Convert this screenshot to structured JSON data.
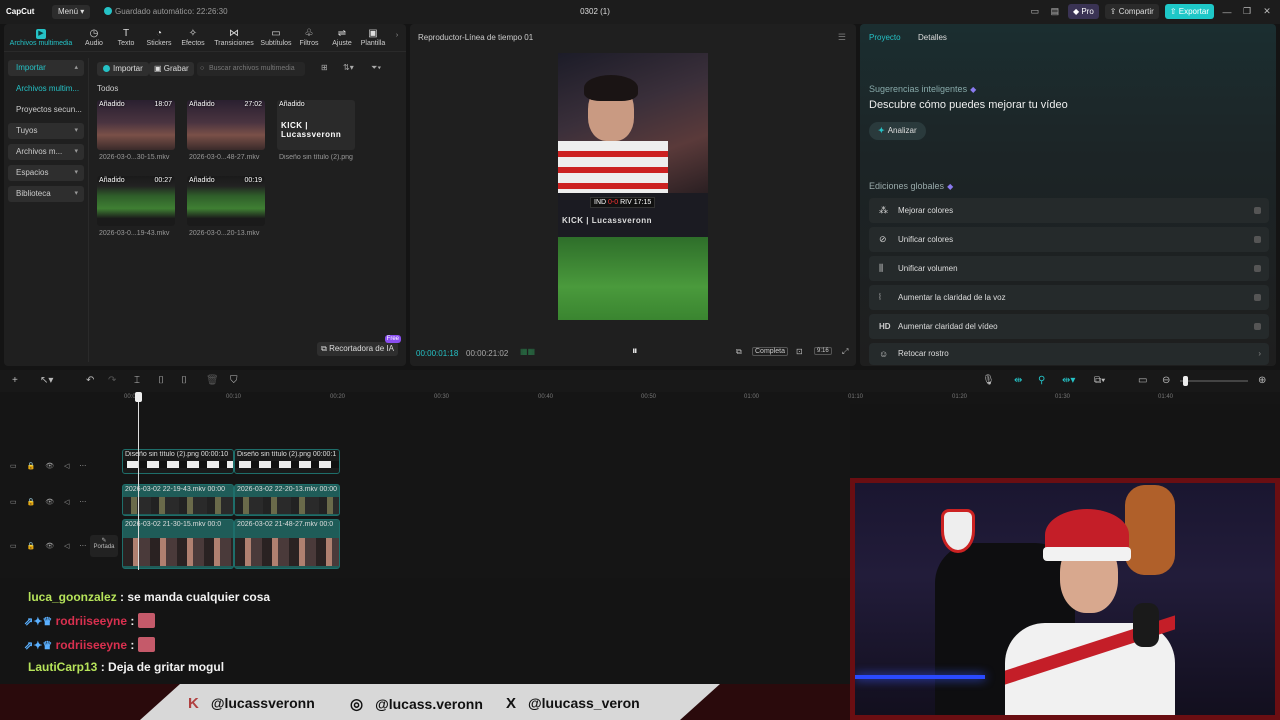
{
  "app": {
    "logo": "CapCut",
    "menu": "Menú",
    "autosave": "Guardado automático: 22:26:30",
    "project": "0302 (1)"
  },
  "titlebar": {
    "pro": "Pro",
    "share": "Compartir",
    "export": "Exportar"
  },
  "toolbar": [
    {
      "label": "Archivos multimedia",
      "icon": "media-icon"
    },
    {
      "label": "Audio",
      "icon": "audio-icon"
    },
    {
      "label": "Texto",
      "icon": "text-icon"
    },
    {
      "label": "Stickers",
      "icon": "sticker-icon"
    },
    {
      "label": "Efectos",
      "icon": "effects-icon"
    },
    {
      "label": "Transiciones",
      "icon": "transitions-icon"
    },
    {
      "label": "Subtítulos",
      "icon": "subtitles-icon"
    },
    {
      "label": "Filtros",
      "icon": "filters-icon"
    },
    {
      "label": "Ajuste",
      "icon": "adjust-icon"
    },
    {
      "label": "Plantilla",
      "icon": "template-icon"
    }
  ],
  "sidebar": [
    {
      "label": "Importar"
    },
    {
      "label": "Archivos multim..."
    },
    {
      "label": "Proyectos secun..."
    },
    {
      "label": "Tuyos"
    },
    {
      "label": "Archivos m..."
    },
    {
      "label": "Espacios"
    },
    {
      "label": "Biblioteca"
    }
  ],
  "media": {
    "import": "Importar",
    "record": "Grabar",
    "search_placeholder": "Buscar archivos multimedia",
    "all": "Todos",
    "items": [
      {
        "badge": "Añadido",
        "duration": "18:07",
        "name": "2026-03-0...30-15.mkv"
      },
      {
        "badge": "Añadido",
        "duration": "27:02",
        "name": "2026-03-0...48-27.mkv"
      },
      {
        "badge": "Añadido",
        "duration": "",
        "name": "Diseño sin título (2).png",
        "logo": "KICK | Lucassveronn"
      },
      {
        "badge": "Añadido",
        "duration": "00:27",
        "name": "2026-03-0...19-43.mkv"
      },
      {
        "badge": "Añadido",
        "duration": "00:19",
        "name": "2026-03-0...20-13.mkv"
      }
    ],
    "ai_cutter": "Recortadora de IA",
    "free": "Free"
  },
  "player": {
    "title": "Reproductor-Línea de tiempo 01",
    "current": "00:00:01:18",
    "total": "00:00:21:02",
    "full": "Completa",
    "ratio": "9:16",
    "score": {
      "home": "IND",
      "result": "0-0",
      "away": "RIV",
      "clock": "17:15"
    },
    "watermark": "KICK | Lucassveronn"
  },
  "inspector": {
    "tab_project": "Proyecto",
    "tab_details": "Detalles",
    "suggest_header": "Sugerencias inteligentes",
    "suggest_title": "Descubre cómo puedes mejorar tu vídeo",
    "analyze": "Analizar",
    "global_header": "Ediciones globales",
    "items": [
      {
        "label": "Mejorar colores",
        "icon": "wand-icon"
      },
      {
        "label": "Unificar colores",
        "icon": "palette-icon"
      },
      {
        "label": "Unificar volumen",
        "icon": "volume-sliders-icon"
      },
      {
        "label": "Aumentar la claridad de la voz",
        "icon": "voice-wave-icon"
      },
      {
        "label": "Aumentar claridad del vídeo",
        "icon": "hd-icon"
      },
      {
        "label": "Retocar rostro",
        "icon": "face-retouch-icon"
      }
    ]
  },
  "timeline": {
    "ticks": [
      "00:00",
      "00:10",
      "00:20",
      "00:30",
      "00:40",
      "00:50",
      "01:00",
      "01:10",
      "01:20",
      "01:30",
      "01:40"
    ],
    "clips": [
      {
        "label": "Diseño sin título (2).png",
        "time": "00:00:10",
        "kind": "png"
      },
      {
        "label": "Diseño sin título (2).png",
        "time": "00:00:1",
        "kind": "png"
      },
      {
        "label": "2026-03-02 22-19-43.mkv",
        "time": "00:00",
        "kind": "mkv"
      },
      {
        "label": "2026-03-02 22-20-13.mkv",
        "time": "00:00",
        "kind": "mkv"
      },
      {
        "label": "2026-03-02 21-30-15.mkv",
        "time": "00:0",
        "kind": "room"
      },
      {
        "label": "2026-03-02 21-48-27.mkv",
        "time": "00:0",
        "kind": "room"
      }
    ],
    "cover": "Portada"
  },
  "chat": [
    {
      "user": "luca_goonzalez",
      "text": ": se manda cualquier cosa",
      "badges": "",
      "emote": false,
      "color": "#b6e35a"
    },
    {
      "user": "rodriiseeyne",
      "text": ":",
      "badges": "⇗✦♛",
      "emote": true,
      "color": "#d9304f"
    },
    {
      "user": "rodriiseeyne",
      "text": ":",
      "badges": "⇗✦♛",
      "emote": true,
      "color": "#d9304f"
    },
    {
      "user": "LautiCarp13",
      "text": ": Deja de gritar mogul",
      "badges": "",
      "emote": false,
      "color": "#b6e35a"
    }
  ],
  "socials": [
    {
      "icon": "kick-icon",
      "glyph": "K",
      "handle": "@lucassveronn"
    },
    {
      "icon": "instagram-icon",
      "glyph": "◎",
      "handle": "@lucass.veronn"
    },
    {
      "icon": "x-icon",
      "glyph": "X",
      "handle": "@luucass_veron"
    }
  ]
}
